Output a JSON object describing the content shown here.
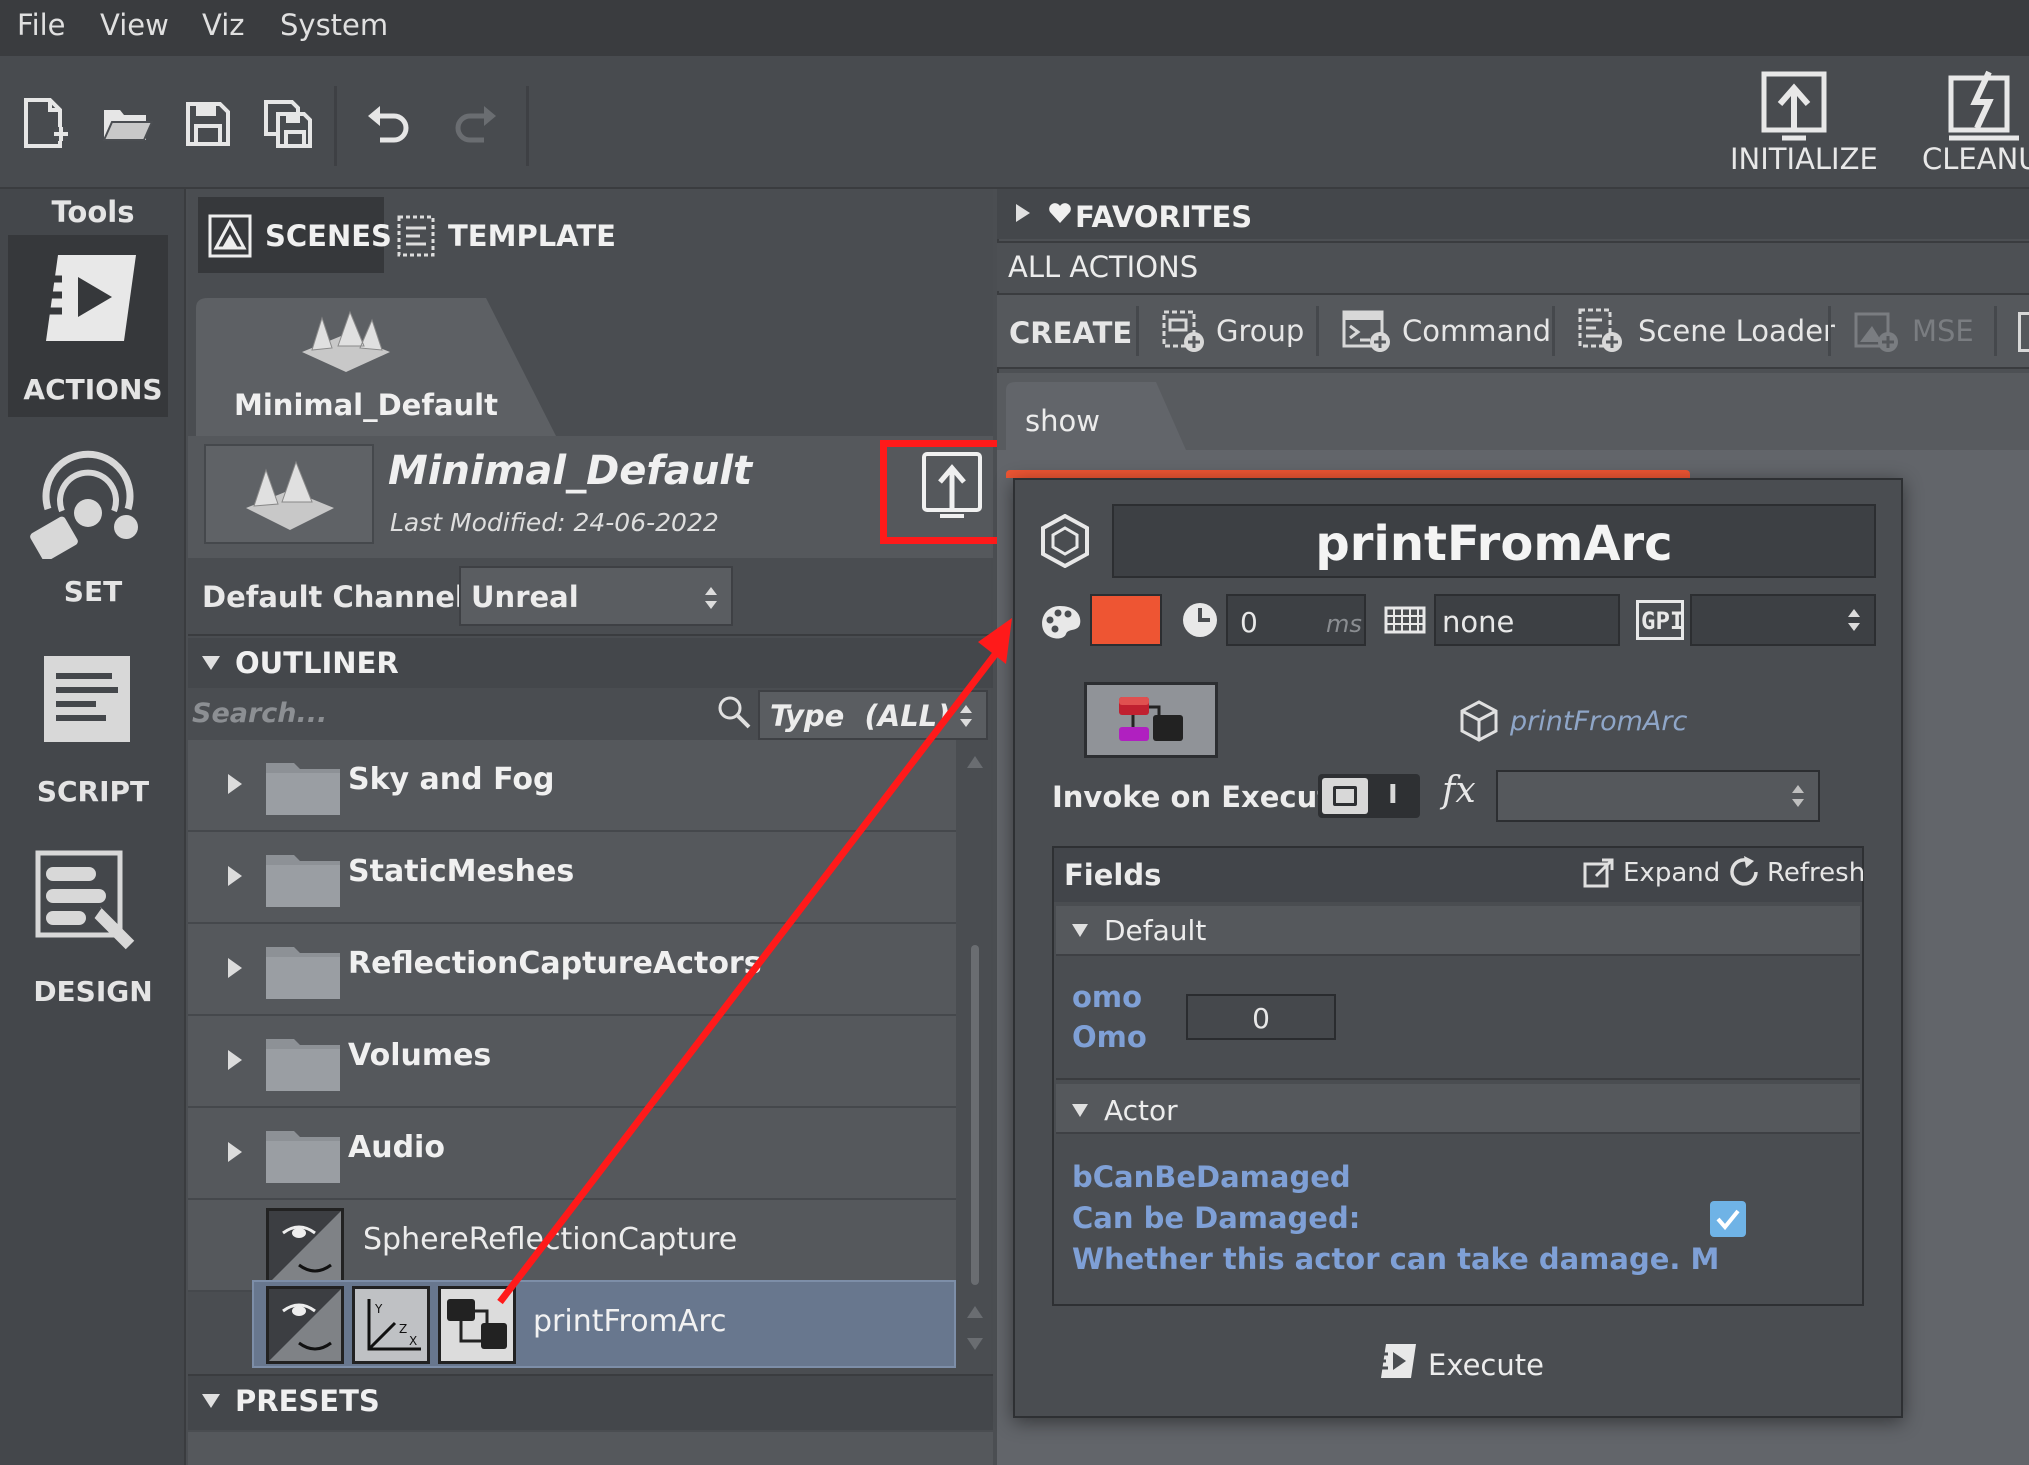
{
  "menubar": {
    "items": [
      "File",
      "View",
      "Viz",
      "System"
    ]
  },
  "toolbar": {
    "icons": [
      "new-file-icon",
      "open-folder-icon",
      "save-icon",
      "save-all-icon",
      "undo-icon",
      "redo-icon"
    ],
    "initialize_label": "INITIALIZE",
    "cleanup_label": "CLEANU"
  },
  "tools": {
    "header": "Tools",
    "items": [
      {
        "label": "ACTIONS",
        "icon": "play-action-icon",
        "active": true
      },
      {
        "label": "SET",
        "icon": "set-icon",
        "active": false
      },
      {
        "label": "SCRIPT",
        "icon": "script-icon",
        "active": false
      },
      {
        "label": "DESIGN",
        "icon": "design-icon",
        "active": false
      }
    ]
  },
  "scenes_panel": {
    "tabs": [
      {
        "label": "SCENES",
        "active": true
      },
      {
        "label": "TEMPLATE",
        "active": false
      }
    ],
    "scene_tab": "Minimal_Default",
    "scene_title": "Minimal_Default",
    "last_modified": "Last Modified: 24-06-2022",
    "default_channel_label": "Default Channel:",
    "default_channel_value": "Unreal",
    "outliner_label": "OUTLINER",
    "search_placeholder": "Search...",
    "type_filter": "Type  (ALL)",
    "rows": [
      {
        "label": "Sky and Fog",
        "kind": "folder"
      },
      {
        "label": "StaticMeshes",
        "kind": "folder"
      },
      {
        "label": "ReflectionCaptureActors",
        "kind": "folder"
      },
      {
        "label": "Volumes",
        "kind": "folder"
      },
      {
        "label": "Audio",
        "kind": "folder"
      },
      {
        "label": "SphereReflectionCapture",
        "kind": "actor"
      },
      {
        "label": "printFromArc",
        "kind": "actor",
        "selected": true
      }
    ],
    "presets_label": "PRESETS"
  },
  "actions_panel": {
    "favorites_label": "FAVORITES",
    "all_actions_label": "ALL ACTIONS",
    "create_label": "CREATE",
    "create_items": [
      "Group",
      "Command",
      "Scene Loader",
      "MSE"
    ],
    "show_tab": "show"
  },
  "popup": {
    "title": "printFromArc",
    "delay_value": "0",
    "delay_unit": "ms",
    "keyboard_value": "none",
    "gpi_label": "GPI",
    "item_name": "printFromArc",
    "invoke_label": "Invoke on Execute",
    "toggle_text": "I",
    "fx_label": "fx",
    "fields_label": "Fields",
    "expand_label": "Expand",
    "refresh_label": "Refresh",
    "default_group": "Default",
    "omo_name": "omo",
    "omo_display": "Omo",
    "omo_value": "0",
    "actor_group": "Actor",
    "damage_name": "bCanBeDamaged",
    "damage_display": "Can be Damaged:",
    "damage_desc": "Whether this actor can take damage. M",
    "damage_checked": true,
    "execute_label": "Execute",
    "color_swatch": "#ee5533"
  },
  "annotation": {
    "highlight_color": "#ff1a1a"
  }
}
